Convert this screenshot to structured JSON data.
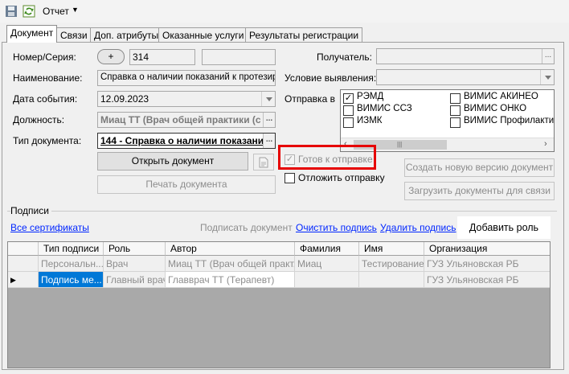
{
  "toolbar": {
    "save_icon": "save-icon",
    "refresh_icon": "refresh-icon",
    "report_label": "Отчет"
  },
  "tabs": [
    {
      "label": "Документ",
      "active": true
    },
    {
      "label": "Связи"
    },
    {
      "label": "Доп. атрибуты"
    },
    {
      "label": "Оказанные услуги"
    },
    {
      "label": "Результаты регистрации"
    }
  ],
  "form": {
    "number_label": "Номер/Серия:",
    "plus_label": "+",
    "number_value": "314",
    "series_value": "",
    "name_label": "Наименование:",
    "name_value": "Справка о наличии показаний к протезиро",
    "date_label": "Дата события:",
    "date_value": "12.09.2023",
    "position_label": "Должность:",
    "position_value": "Миац ТТ (Врач общей практики (с",
    "doctype_label": "Тип документа:",
    "doctype_value": "144 - Справка о наличии показани",
    "ellipsis": "...",
    "recipient_label": "Получатель:",
    "recipient_value": "",
    "detection_label": "Условие выявления:",
    "detection_value": "",
    "send_to_label": "Отправка в"
  },
  "send_to": [
    {
      "label": "РЭМД",
      "checked": true
    },
    {
      "label": "ВИМИС АКИНЕО",
      "checked": false
    },
    {
      "label": "ВИМИС ССЗ",
      "checked": false
    },
    {
      "label": "ВИМИС ОНКО",
      "checked": false
    },
    {
      "label": "ИЗМК",
      "checked": false
    },
    {
      "label": "ВИМИС Профилактик",
      "checked": false
    }
  ],
  "buttons": {
    "open_doc": "Открыть документ",
    "print_doc": "Печать документа",
    "new_version": "Создать новую версию документ",
    "load_docs": "Загрузить документы для связи"
  },
  "status": {
    "ready_label": "Готов к отправке",
    "ready_checked": true,
    "postpone_label": "Отложить отправку",
    "postpone_checked": false
  },
  "signatures": {
    "group_label": "Подписи",
    "all_certs": "Все сертификаты",
    "sign_doc": "Подписать документ",
    "clear_sig": "Очистить подпись",
    "delete_sig": "Удалить подпись",
    "add_role": "Добавить роль",
    "columns": [
      "Тип подписи",
      "Роль",
      "Автор",
      "Фамилия",
      "Имя",
      "Организация"
    ],
    "rows": [
      [
        "Персональн...",
        "Врач",
        "Миац ТТ (Врач общей практ...",
        "Миац",
        "Тестирование",
        "ГУЗ Ульяновская РБ"
      ],
      [
        "Подпись ме...",
        "Главный врач",
        "Главврач ТТ (Терапевт)",
        "",
        "",
        "ГУЗ Ульяновская РБ"
      ]
    ]
  },
  "colors": {
    "highlight": "#e60000",
    "link": "#0026ff",
    "selection": "#0078d7"
  }
}
